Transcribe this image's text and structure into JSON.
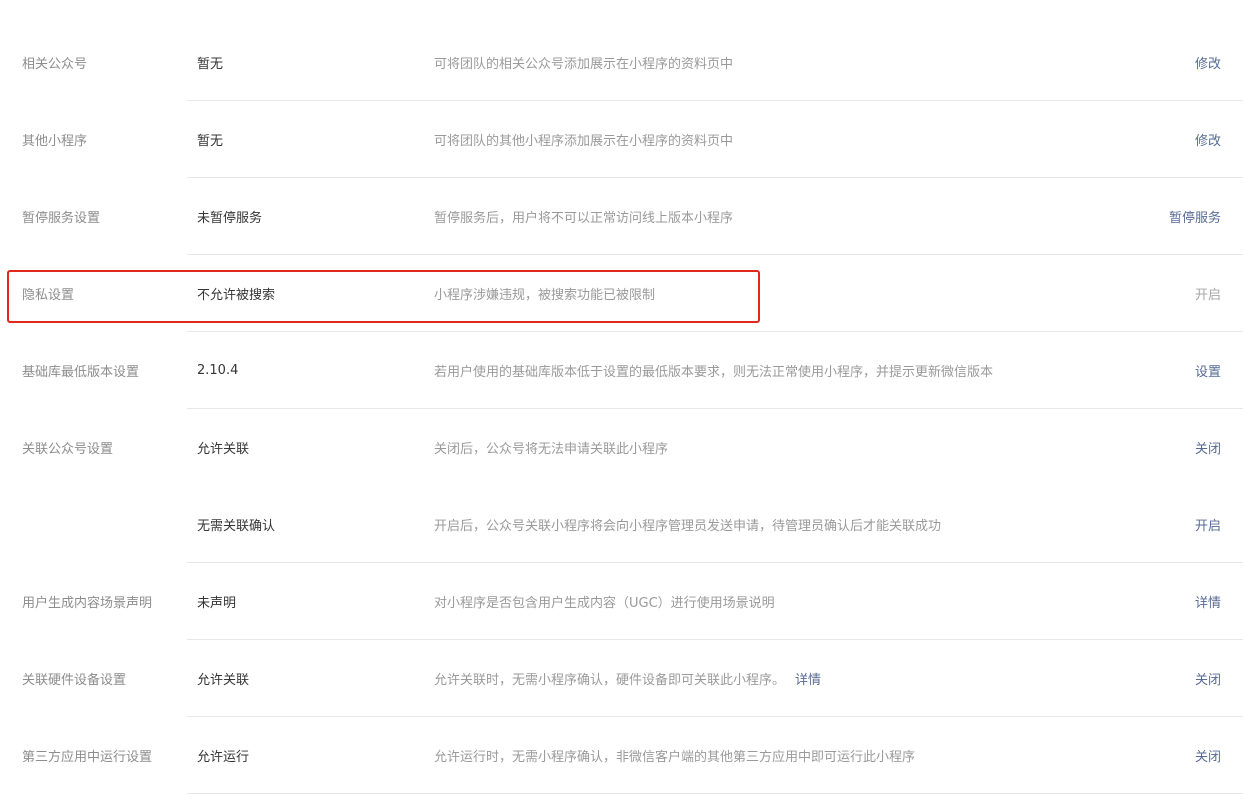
{
  "rows": [
    {
      "label": "相关公众号",
      "value": "暂无",
      "desc": "可将团队的相关公众号添加展示在小程序的资料页中",
      "action": "修改"
    },
    {
      "label": "其他小程序",
      "value": "暂无",
      "desc": "可将团队的其他小程序添加展示在小程序的资料页中",
      "action": "修改"
    },
    {
      "label": "暂停服务设置",
      "value": "未暂停服务",
      "desc": "暂停服务后，用户将不可以正常访问线上版本小程序",
      "action": "暂停服务"
    },
    {
      "label": "隐私设置",
      "value": "不允许被搜索",
      "desc": "小程序涉嫌违规，被搜索功能已被限制",
      "action": "开启"
    },
    {
      "label": "基础库最低版本设置",
      "value": "2.10.4",
      "desc": "若用户使用的基础库版本低于设置的最低版本要求，则无法正常使用小程序，并提示更新微信版本",
      "action": "设置"
    },
    {
      "label": "关联公众号设置",
      "value": "允许关联",
      "desc": "关闭后，公众号将无法申请关联此小程序",
      "action": "关闭"
    },
    {
      "label": "",
      "value": "无需关联确认",
      "desc": "开启后，公众号关联小程序将会向小程序管理员发送申请，待管理员确认后才能关联成功",
      "action": "开启"
    },
    {
      "label": "用户生成内容场景声明",
      "value": "未声明",
      "desc": "对小程序是否包含用户生成内容（UGC）进行使用场景说明",
      "action": "详情"
    },
    {
      "label": "关联硬件设备设置",
      "value": "允许关联",
      "desc": "允许关联时，无需小程序确认，硬件设备即可关联此小程序。",
      "desc_link": "详情",
      "action": "关闭"
    },
    {
      "label": "第三方应用中运行设置",
      "value": "允许运行",
      "desc": "允许运行时，无需小程序确认，非微信客户端的其他第三方应用中即可运行此小程序",
      "action": "关闭"
    }
  ],
  "colors": {
    "link": "#576b95",
    "disabled": "#a6a6a6",
    "highlight": "#e0281f"
  }
}
